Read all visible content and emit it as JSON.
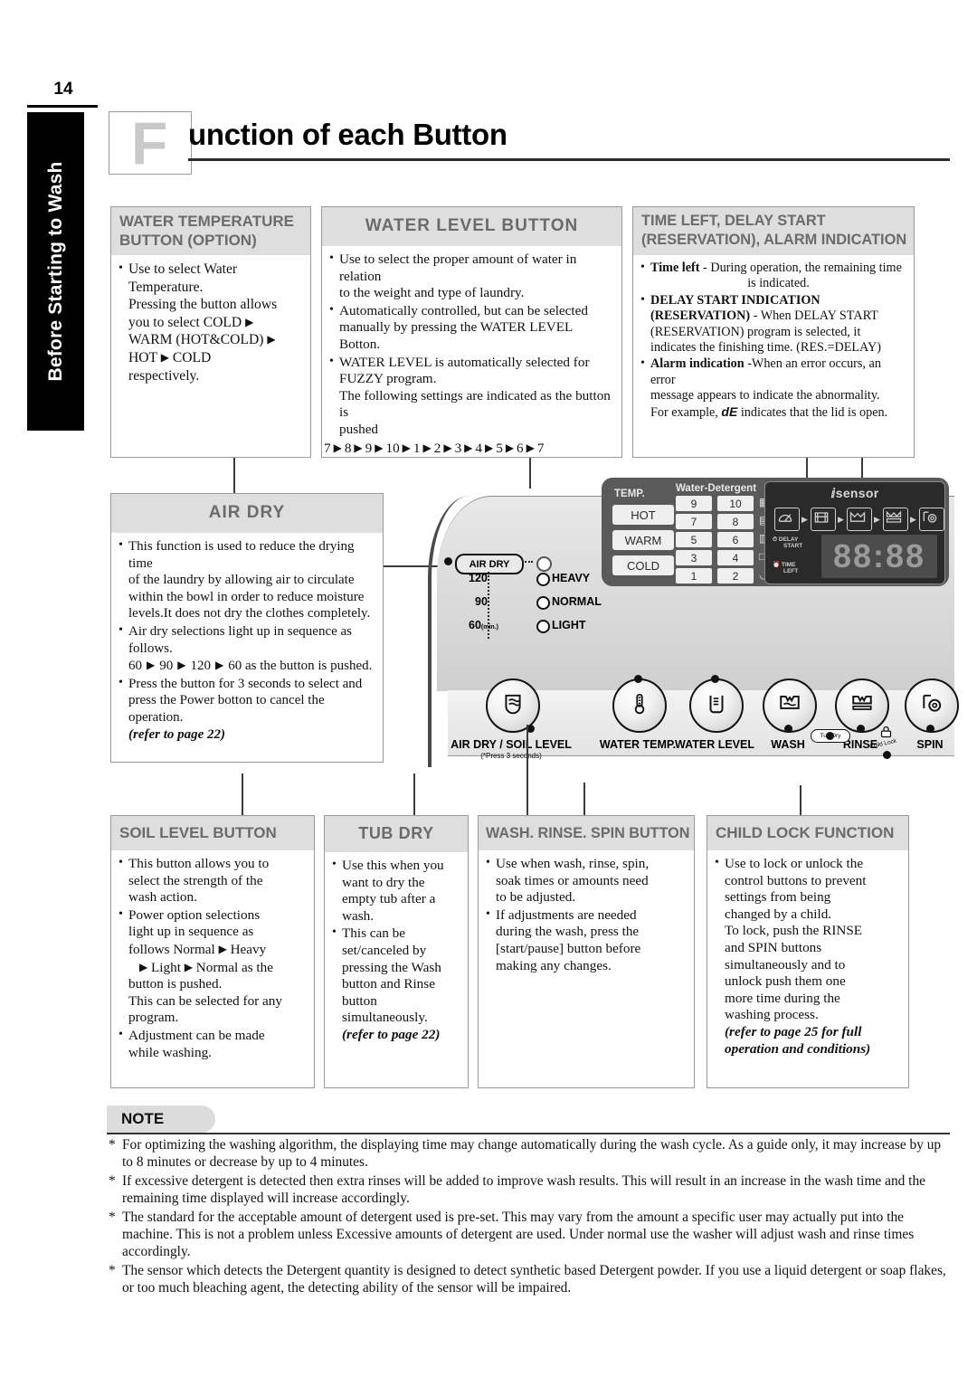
{
  "page": {
    "number": "14",
    "side_tab": "Before Starting to Wash",
    "title_dropcap": "F",
    "title_rest": "unction of each Button"
  },
  "boxes": {
    "water_temperature": {
      "title_line1": "WATER TEMPERATURE",
      "title_line2": "BUTTON (OPTION)",
      "b1_l1": "Use to select Water",
      "b1_l2": "Temperature.",
      "b1_l3": "Pressing the button allows",
      "b1_l4": "you to select  COLD",
      "b1_l5": "WARM (HOT&COLD)",
      "b1_l6a": "HOT",
      "b1_l6b": "COLD",
      "b1_l7": "respectively."
    },
    "water_level": {
      "title": "WATER LEVEL BUTTON",
      "b1_l1": "Use to select the proper amount of water in relation",
      "b1_l2": "to the weight and type of laundry.",
      "b2_l1": "Automatically controlled, but can be selected",
      "b2_l2": "manually by pressing the WATER LEVEL Botton.",
      "b3_l1": "WATER LEVEL is automatically selected for",
      "b3_l2": "FUZZY program.",
      "b3_l3": "The following settings are indicated as the button is",
      "b3_l4": "pushed",
      "sequence": [
        "7",
        "8",
        "9",
        "10",
        "1",
        "2",
        "3",
        "4",
        "5",
        "6",
        "7"
      ]
    },
    "time_left": {
      "title_line1": "TIME LEFT, DELAY START",
      "title_line2": "(RESERVATION), ALARM INDICATION",
      "b1_bold": "Time left",
      "b1_rest": " - During operation, the remaining time",
      "b1_l2": "is indicated.",
      "b2_bold_l1": "DELAY START INDICATION",
      "b2_bold_l2": "(RESERVATION)",
      "b2_rest_l2": " - When DELAY START",
      "b2_l3": "(RESERVATION)  program is selected, it",
      "b2_l4": "indicates the finishing time. (RES.=DELAY)",
      "b3_bold": "Alarm indication",
      "b3_rest": " -When an error occurs, an error",
      "b3_l2": "message appears to indicate the abnormality.",
      "b3_l3a": "For example,",
      "b3_code": "dE",
      "b3_l3b": "indicates that the lid is open."
    },
    "air_dry": {
      "title": "AIR DRY",
      "b1_l1": "This function is used to reduce the drying time",
      "b1_l2": "of the laundry by allowing air to circulate",
      "b1_l3": "within the bowl in order to reduce moisture",
      "b1_l4": "levels.It does not dry the clothes completely.",
      "b2_l1": "Air dry selections light up in sequence as",
      "b2_l2": "follows.",
      "b2_seq": [
        "60",
        "90",
        "120",
        "60"
      ],
      "b2_seq_tail": " as the button is pushed.",
      "b3_l1": "Press the button for 3 seconds to select and",
      "b3_l2": "press the Power botton to cancel the operation.",
      "refer": "(refer to page 22)"
    },
    "soil_level": {
      "title": "SOIL LEVEL BUTTON",
      "b1_l1": "This button allows you to",
      "b1_l2": "select the strength of the",
      "b1_l3": "wash action.",
      "b2_l1": "Power option selections",
      "b2_l2": "light up in sequence as",
      "b2_l3a": "follows Normal",
      "b2_l3b": "Heavy",
      "b2_l4a": "Light",
      "b2_l4b": "Normal as the",
      "b2_l5": "button is pushed.",
      "b2_l6": "This can be selected for any",
      "b2_l7": "program.",
      "b3_l1": "Adjustment can be made",
      "b3_l2": "while washing."
    },
    "tub_dry": {
      "title": "TUB DRY",
      "b1_l1": "Use this when you",
      "b1_l2": "want to dry the",
      "b1_l3": "empty tub after a",
      "b1_l4": "wash.",
      "b2_l1": "This can be",
      "b2_l2": "set/canceled by",
      "b2_l3": "pressing the Wash",
      "b2_l4": "button and Rinse",
      "b2_l5": "button",
      "b2_l6": "simultaneously.",
      "refer": "(refer to page 22)"
    },
    "wash_rinse_spin": {
      "title": "WASH. RINSE. SPIN BUTTON",
      "b1_l1": "Use when wash, rinse, spin,",
      "b1_l2": "soak times or amounts need",
      "b1_l3": "to be adjusted.",
      "b2_l1": "If adjustments are needed",
      "b2_l2": "during the wash, press the",
      "b2_l3": "[start/pause] button before",
      "b2_l4": "making any changes."
    },
    "child_lock": {
      "title": "CHILD LOCK FUNCTION",
      "b1_l1": "Use to lock or unlock the",
      "b1_l2": "control buttons to prevent",
      "b1_l3": "settings from being",
      "b1_l4": "changed by a child.",
      "b1_l5": "To lock, push the RINSE",
      "b1_l6": "and SPIN buttons",
      "b1_l7": "simultaneously and to",
      "b1_l8": "unlock push them one",
      "b1_l9": "more time during the",
      "b1_l10": "washing process.",
      "refer_l1": "(refer to page 25 for full",
      "refer_l2": "operation and conditions)"
    }
  },
  "panel": {
    "air_dry_pill": "AIR DRY",
    "air_dry_times": [
      "120",
      "90",
      "60"
    ],
    "air_dry_unit": "(min.)",
    "soil_levels": [
      "HEAVY",
      "NORMAL",
      "LIGHT"
    ],
    "temp_label": "TEMP.",
    "temp_options": [
      "HOT",
      "WARM",
      "COLD"
    ],
    "water_detergent_label": "Water-Detergent",
    "water_detergent_rows": [
      [
        "9",
        "10"
      ],
      [
        "7",
        "8"
      ],
      [
        "5",
        "6"
      ],
      [
        "3",
        "4"
      ],
      [
        "1",
        "2"
      ]
    ],
    "sensor_word": "sensor",
    "delay_start_mini_l1": "DELAY",
    "delay_start_mini_l2": "START",
    "time_left_mini_l1": "TIME",
    "time_left_mini_l2": "LEFT",
    "display_value": "88:88",
    "buttons": [
      {
        "label": "AIR DRY / SOIL LEVEL",
        "sub": "(*Press 3 seconds)"
      },
      {
        "label": "WATER TEMP.",
        "sub": ""
      },
      {
        "label": "WATER LEVEL",
        "sub": ""
      },
      {
        "label": "WASH",
        "sub": ""
      },
      {
        "label": "RINSE",
        "sub": ""
      },
      {
        "label": "SPIN",
        "sub": ""
      }
    ],
    "tub_dry_marker": "Tub Dry",
    "child_lock_marker": "Child Lock"
  },
  "note": {
    "tab": "NOTE",
    "items": [
      "For optimizing the washing algorithm, the displaying time may change automatically during the wash cycle. As a guide only, it may increase by up to 8 minutes or decrease by up to 4 minutes.",
      "If excessive detergent is detected then extra rinses will be added to improve wash results. This will result in an increase in the wash time and the remaining time displayed will increase accordingly.",
      "The standard for the acceptable amount of detergent used is pre-set. This may vary from the amount a specific user may actually put into the machine. This is not a problem unless Excessive amounts of detergent are used. Under normal use the washer will adjust wash and rinse times accordingly.",
      "The sensor which detects the Detergent quantity is designed to detect synthetic based Detergent powder. If you use a liquid detergent or soap flakes, or too much bleaching agent, the detecting ability of the sensor will be impaired."
    ]
  }
}
